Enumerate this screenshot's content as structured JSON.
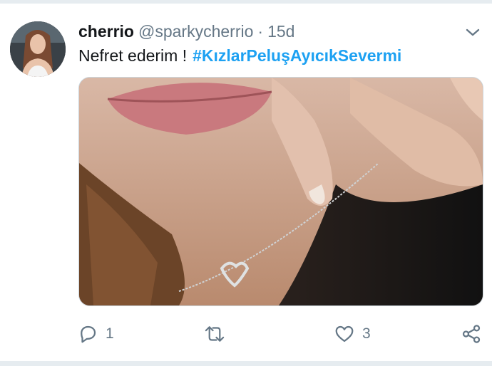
{
  "tweet": {
    "display_name": "cherrio",
    "handle": "@sparkycherrio",
    "separator": "·",
    "time": "15d",
    "text": "Nefret ederim !",
    "hashtag": "#KızlarPeluşAyıcıkSevermi"
  },
  "actions": {
    "reply_count": "1",
    "like_count": "3"
  },
  "colors": {
    "link": "#1da1f2",
    "secondary_text": "#657786",
    "divider": "#e6ecf0"
  },
  "icons": {
    "reply": "reply-icon",
    "retweet": "retweet-icon",
    "like": "heart-icon",
    "share": "share-icon",
    "menu": "chevron-down-icon"
  }
}
